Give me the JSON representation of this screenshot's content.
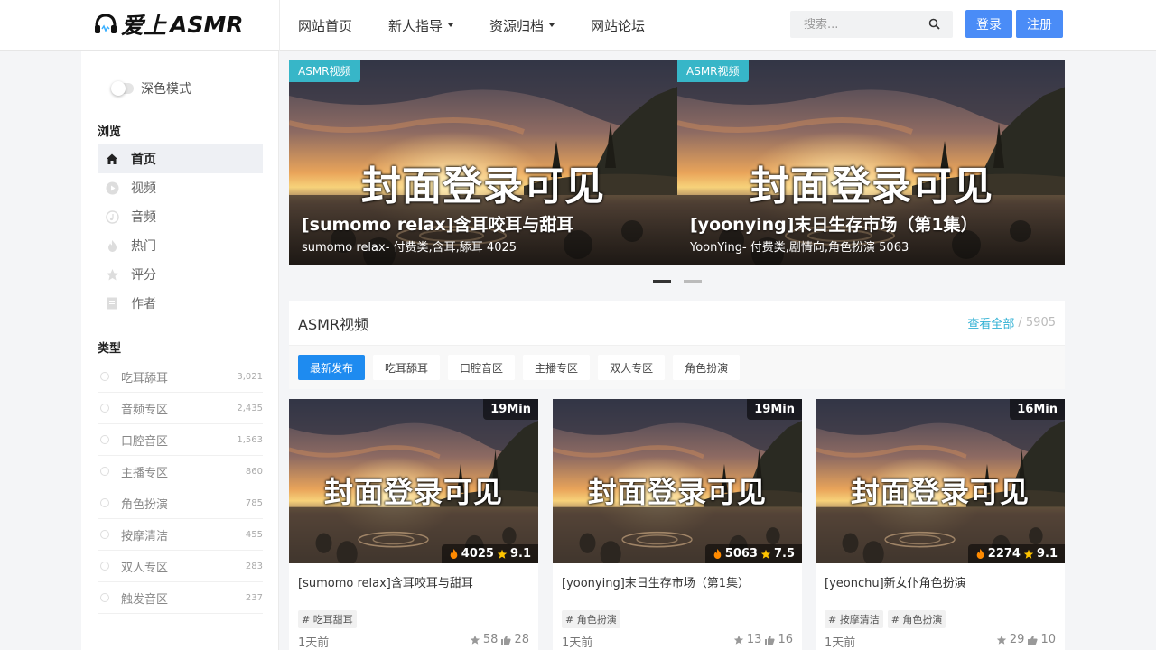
{
  "header": {
    "logo_text": "ASMR",
    "logo_brand_char": "爱上",
    "nav": [
      {
        "label": "网站首页",
        "dropdown": false
      },
      {
        "label": "新人指导",
        "dropdown": true
      },
      {
        "label": "资源归档",
        "dropdown": true
      },
      {
        "label": "网站论坛",
        "dropdown": false
      }
    ],
    "search_placeholder": "搜索...",
    "login_label": "登录",
    "register_label": "注册"
  },
  "sidebar": {
    "dark_mode_label": "深色模式",
    "browse_title": "浏览",
    "browse_items": [
      {
        "label": "首页",
        "icon": "home-icon",
        "active": true
      },
      {
        "label": "视频",
        "icon": "play-icon",
        "active": false
      },
      {
        "label": "音频",
        "icon": "music-icon",
        "active": false
      },
      {
        "label": "热门",
        "icon": "fire-icon",
        "active": false
      },
      {
        "label": "评分",
        "icon": "star-icon",
        "active": false
      },
      {
        "label": "作者",
        "icon": "document-icon",
        "active": false
      }
    ],
    "category_title": "类型",
    "categories": [
      {
        "label": "吃耳舔耳",
        "count": "3,021"
      },
      {
        "label": "音频专区",
        "count": "2,435"
      },
      {
        "label": "口腔音区",
        "count": "1,563"
      },
      {
        "label": "主播专区",
        "count": "860"
      },
      {
        "label": "角色扮演",
        "count": "785"
      },
      {
        "label": "按摩清洁",
        "count": "455"
      },
      {
        "label": "双人专区",
        "count": "283"
      },
      {
        "label": "触发音区",
        "count": "237"
      }
    ]
  },
  "banner": {
    "slides": [
      {
        "badge": "ASMR视频",
        "cover_text": "封面登录可见",
        "title": "[sumomo relax]含耳咬耳与甜耳",
        "subtitle": "sumomo relax- 付费类,含耳,舔耳 4025"
      },
      {
        "badge": "ASMR视频",
        "cover_text": "封面登录可见",
        "title": "[yoonying]末日生存市场（第1集）",
        "subtitle": "YoonYing- 付费类,剧情向,角色扮演 5063"
      }
    ],
    "active_dot": 0
  },
  "section": {
    "title": "ASMR视频",
    "view_all_label": "查看全部",
    "view_all_count": "/ 5905",
    "filters": [
      {
        "label": "最新发布",
        "active": true
      },
      {
        "label": "吃耳舔耳",
        "active": false
      },
      {
        "label": "口腔音区",
        "active": false
      },
      {
        "label": "主播专区",
        "active": false
      },
      {
        "label": "双人专区",
        "active": false
      },
      {
        "label": "角色扮演",
        "active": false
      }
    ]
  },
  "cards": [
    {
      "duration": "19Min",
      "cover_text": "封面登录可见",
      "heat": "4025",
      "score": "9.1",
      "title": "[sumomo relax]含耳咬耳与甜耳",
      "tags": [
        "# 吃耳甜耳"
      ],
      "time": "1天前",
      "stars": "58",
      "likes": "28"
    },
    {
      "duration": "19Min",
      "cover_text": "封面登录可见",
      "heat": "5063",
      "score": "7.5",
      "title": "[yoonying]末日生存市场（第1集）",
      "tags": [
        "# 角色扮演"
      ],
      "time": "1天前",
      "stars": "13",
      "likes": "16"
    },
    {
      "duration": "16Min",
      "cover_text": "封面登录可见",
      "heat": "2274",
      "score": "9.1",
      "title": "[yeonchu]新女仆角色扮演",
      "tags": [
        "# 按摩清洁",
        "# 角色扮演"
      ],
      "time": "1天前",
      "stars": "29",
      "likes": "10"
    }
  ],
  "colors": {
    "primary": "#4a8cf7",
    "filter_active": "#1e8bf0",
    "accent_teal": "#37b6c8",
    "link": "#31b1d4",
    "fire": "#ff8a00",
    "star": "#ffc400"
  }
}
